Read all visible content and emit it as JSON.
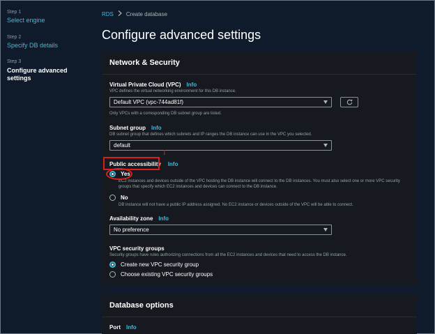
{
  "sidebar": {
    "steps": [
      {
        "num": "Step 1",
        "label": "Select engine"
      },
      {
        "num": "Step 2",
        "label": "Specify DB details"
      },
      {
        "num": "Step 3",
        "label": "Configure advanced settings"
      }
    ]
  },
  "breadcrumb": {
    "root": "RDS",
    "current": "Create database"
  },
  "page_title": "Configure advanced settings",
  "network": {
    "title": "Network & Security",
    "vpc": {
      "label": "Virtual Private Cloud (VPC)",
      "info": "Info",
      "desc": "VPC defines the virtual networking environment for this DB instance.",
      "value": "Default VPC (vpc-744ad81f)",
      "note": "Only VPCs with a corresponding DB subnet group are listed."
    },
    "subnet": {
      "label": "Subnet group",
      "info": "Info",
      "desc": "DB subnet group that defines which subnets and IP ranges the DB instance can use in the VPC you selected.",
      "value": "default"
    },
    "public_access": {
      "label": "Public accessibility",
      "info": "Info",
      "annotation_number": "1",
      "yes_label": "Yes",
      "yes_desc": "EC2 instances and devices outside of the VPC hosting the DB instance will connect to the DB instances. You must also select one or more VPC security groups that specify which EC2 instances and devices can connect to the DB instance.",
      "no_label": "No",
      "no_desc": "DB instance will not have a public IP address assigned. No EC2 instance or devices outside of the VPC will be able to connect."
    },
    "az": {
      "label": "Availability zone",
      "info": "Info",
      "value": "No preference"
    },
    "sg": {
      "label": "VPC security groups",
      "desc": "Security groups have rules authorizing connections from all the EC2 instances and devices that need to access the DB instance.",
      "create_label": "Create new VPC security group",
      "existing_label": "Choose existing VPC security groups"
    }
  },
  "db_options": {
    "title": "Database options",
    "port_label": "Port",
    "port_info": "Info"
  },
  "colors": {
    "accent": "#44b9d6",
    "annotation": "#d9201f",
    "panel": "#16191f",
    "background": "#0f1b2a"
  },
  "icons": {
    "refresh": "refresh-icon",
    "breadcrumb_separator": "chevron-right-icon",
    "select_caret": "caret-down-icon"
  }
}
